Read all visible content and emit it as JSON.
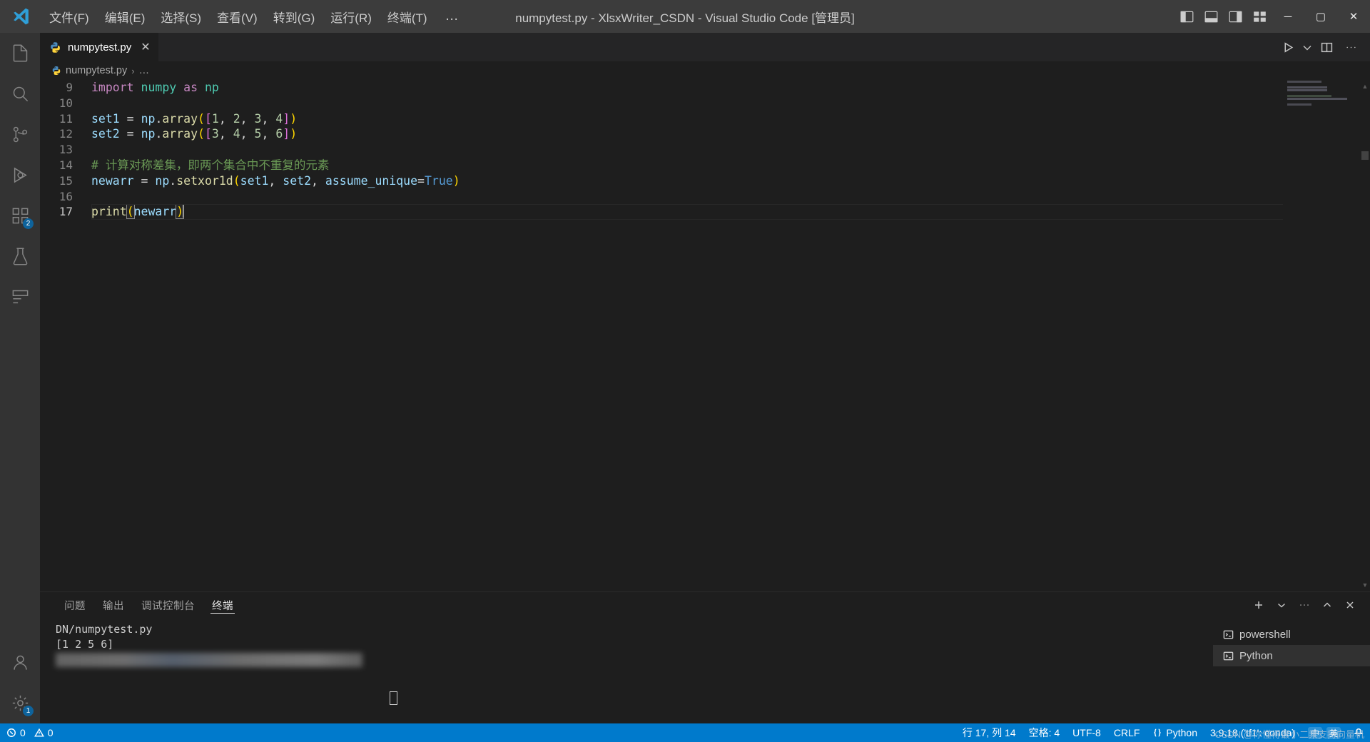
{
  "titlebar": {
    "logo_icon": "vscode-logo-icon",
    "menus": [
      "文件(F)",
      "编辑(E)",
      "选择(S)",
      "查看(V)",
      "转到(G)",
      "运行(R)",
      "终端(T)"
    ],
    "more_label": "…",
    "title": "numpytest.py - XlsxWriter_CSDN - Visual Studio Code [管理员]",
    "layout_icons": [
      "panel-left-icon",
      "panel-bottom-icon",
      "panel-right-icon",
      "customize-layout-icon"
    ],
    "window_buttons": {
      "minimize": "─",
      "maximize": "▢",
      "close": "✕"
    }
  },
  "activitybar": {
    "items": [
      {
        "name": "explorer",
        "icon": "files-icon",
        "badge": ""
      },
      {
        "name": "search",
        "icon": "search-icon",
        "badge": ""
      },
      {
        "name": "source-control",
        "icon": "source-control-icon",
        "badge": ""
      },
      {
        "name": "run-debug",
        "icon": "run-debug-icon",
        "badge": ""
      },
      {
        "name": "extensions",
        "icon": "extensions-icon",
        "badge": "2"
      },
      {
        "name": "testing",
        "icon": "beaker-icon",
        "badge": ""
      },
      {
        "name": "remote-explorer",
        "icon": "remote-explorer-icon",
        "badge": ""
      }
    ],
    "bottom": [
      {
        "name": "accounts",
        "icon": "account-icon",
        "badge": ""
      },
      {
        "name": "settings",
        "icon": "gear-icon",
        "badge": "1"
      }
    ]
  },
  "editor": {
    "tab": {
      "label": "numpytest.py",
      "icon": "python-file-icon",
      "close": "✕"
    },
    "actions": [
      "run-icon",
      "run-dropdown-icon",
      "split-editor-icon",
      "more-actions-icon"
    ],
    "breadcrumb": {
      "file": "numpytest.py",
      "separator": "›",
      "overflow": "…"
    },
    "lines": [
      {
        "num": "9",
        "tokens": [
          {
            "t": "import",
            "c": "kw"
          },
          {
            "t": " ",
            "c": "op"
          },
          {
            "t": "numpy",
            "c": "mod"
          },
          {
            "t": " ",
            "c": "op"
          },
          {
            "t": "as",
            "c": "kw"
          },
          {
            "t": " ",
            "c": "op"
          },
          {
            "t": "np",
            "c": "mod"
          }
        ]
      },
      {
        "num": "10",
        "tokens": []
      },
      {
        "num": "11",
        "tokens": [
          {
            "t": "set1",
            "c": "var"
          },
          {
            "t": " = ",
            "c": "op"
          },
          {
            "t": "np",
            "c": "var"
          },
          {
            "t": ".",
            "c": "op"
          },
          {
            "t": "array",
            "c": "fn"
          },
          {
            "t": "(",
            "c": "br1"
          },
          {
            "t": "[",
            "c": "br2"
          },
          {
            "t": "1",
            "c": "num"
          },
          {
            "t": ", ",
            "c": "op"
          },
          {
            "t": "2",
            "c": "num"
          },
          {
            "t": ", ",
            "c": "op"
          },
          {
            "t": "3",
            "c": "num"
          },
          {
            "t": ", ",
            "c": "op"
          },
          {
            "t": "4",
            "c": "num"
          },
          {
            "t": "]",
            "c": "br2"
          },
          {
            "t": ")",
            "c": "br1"
          }
        ]
      },
      {
        "num": "12",
        "tokens": [
          {
            "t": "set2",
            "c": "var"
          },
          {
            "t": " = ",
            "c": "op"
          },
          {
            "t": "np",
            "c": "var"
          },
          {
            "t": ".",
            "c": "op"
          },
          {
            "t": "array",
            "c": "fn"
          },
          {
            "t": "(",
            "c": "br1"
          },
          {
            "t": "[",
            "c": "br2"
          },
          {
            "t": "3",
            "c": "num"
          },
          {
            "t": ", ",
            "c": "op"
          },
          {
            "t": "4",
            "c": "num"
          },
          {
            "t": ", ",
            "c": "op"
          },
          {
            "t": "5",
            "c": "num"
          },
          {
            "t": ", ",
            "c": "op"
          },
          {
            "t": "6",
            "c": "num"
          },
          {
            "t": "]",
            "c": "br2"
          },
          {
            "t": ")",
            "c": "br1"
          }
        ]
      },
      {
        "num": "13",
        "tokens": []
      },
      {
        "num": "14",
        "tokens": [
          {
            "t": "# 计算对称差集，即两个集合中不重复的元素",
            "c": "cmt"
          }
        ]
      },
      {
        "num": "15",
        "tokens": [
          {
            "t": "newarr",
            "c": "var"
          },
          {
            "t": " = ",
            "c": "op"
          },
          {
            "t": "np",
            "c": "var"
          },
          {
            "t": ".",
            "c": "op"
          },
          {
            "t": "setxor1d",
            "c": "fn"
          },
          {
            "t": "(",
            "c": "br1"
          },
          {
            "t": "set1",
            "c": "var"
          },
          {
            "t": ", ",
            "c": "op"
          },
          {
            "t": "set2",
            "c": "var"
          },
          {
            "t": ", ",
            "c": "op"
          },
          {
            "t": "assume_unique",
            "c": "var"
          },
          {
            "t": "=",
            "c": "op"
          },
          {
            "t": "True",
            "c": "const"
          },
          {
            "t": ")",
            "c": "br1"
          }
        ]
      },
      {
        "num": "16",
        "tokens": []
      },
      {
        "num": "17",
        "tokens": [
          {
            "t": "print",
            "c": "fn"
          },
          {
            "t": "(",
            "c": "br1 bracket-hl"
          },
          {
            "t": "newarr",
            "c": "var"
          },
          {
            "t": ")",
            "c": "br1 bracket-hl"
          }
        ]
      }
    ],
    "active_line_index": 8
  },
  "panel": {
    "tabs": [
      "问题",
      "输出",
      "调试控制台",
      "终端"
    ],
    "active_tab": "终端",
    "actions": [
      "new-terminal-icon",
      "new-terminal-dropdown-icon",
      "more-panel-actions-icon",
      "maximize-panel-icon",
      "close-panel-icon"
    ],
    "terminal_lines": [
      "DN/numpytest.py",
      "[1 2 5 6]"
    ],
    "terminal_list": [
      {
        "label": "powershell",
        "icon": "terminal-icon",
        "active": false
      },
      {
        "label": "Python",
        "icon": "terminal-icon",
        "active": true
      }
    ]
  },
  "statusbar": {
    "left": [
      {
        "name": "remote-indicator",
        "icon": "remote-icon",
        "label": ""
      },
      {
        "name": "problems",
        "icon": "error-icon",
        "label": "0"
      },
      {
        "name": "warnings",
        "icon": "warning-icon",
        "label": "0"
      }
    ],
    "right": [
      {
        "name": "cursor-position",
        "label": "行 17, 列 14"
      },
      {
        "name": "indentation",
        "label": "空格: 4"
      },
      {
        "name": "encoding",
        "label": "UTF-8"
      },
      {
        "name": "eol",
        "label": "CRLF"
      },
      {
        "name": "language-mode",
        "label": "Python"
      },
      {
        "name": "python-version",
        "label": "3.9.18 ('tf1': conda)"
      },
      {
        "name": "bell",
        "label": ""
      }
    ],
    "ime": {
      "lang": "中",
      "mode": "英",
      "pills": [
        "中",
        "英"
      ]
    },
    "accent_color": "#007acc"
  },
  "watermark": "CSDN @你懂得最小二乘支持向量机"
}
